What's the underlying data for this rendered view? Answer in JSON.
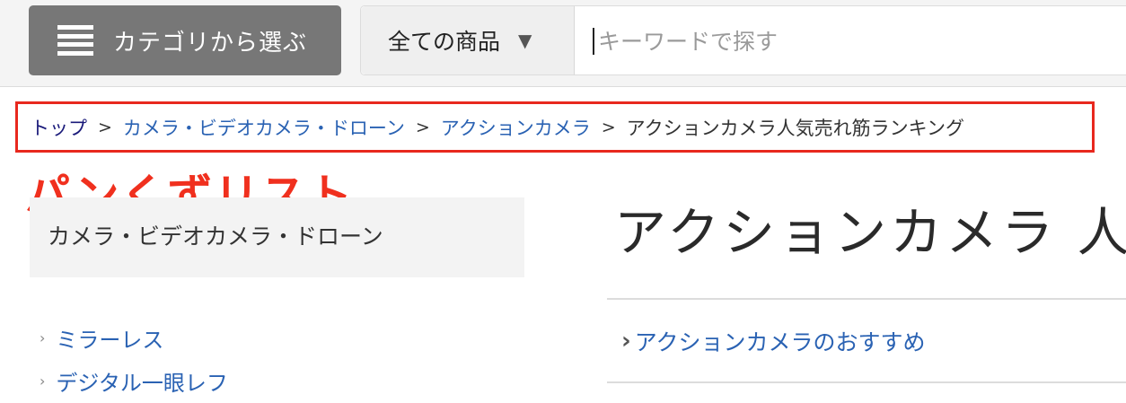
{
  "header": {
    "category_button_label": "カテゴリから選ぶ",
    "search_scope": "全ての商品",
    "search_placeholder": "キーワードで探す",
    "search_value": ""
  },
  "breadcrumb": {
    "items": [
      {
        "label": "トップ"
      },
      {
        "label": "カメラ・ビデオカメラ・ドローン"
      },
      {
        "label": "アクションカメラ"
      }
    ],
    "current": "アクションカメラ人気売れ筋ランキング",
    "separator": ">"
  },
  "annotation": {
    "label": "パンくずリスト",
    "color": "#f0301e"
  },
  "sidebar": {
    "header": "カメラ・ビデオカメラ・ドローン",
    "items": [
      {
        "label": "ミラーレス"
      },
      {
        "label": "デジタル一眼レフ"
      }
    ]
  },
  "main": {
    "title": "アクションカメラ 人",
    "recommend_link": "アクションカメラのおすすめ"
  },
  "colors": {
    "link": "#2a62b3",
    "highlight_border": "#e8281e",
    "category_button_bg": "#777777"
  }
}
